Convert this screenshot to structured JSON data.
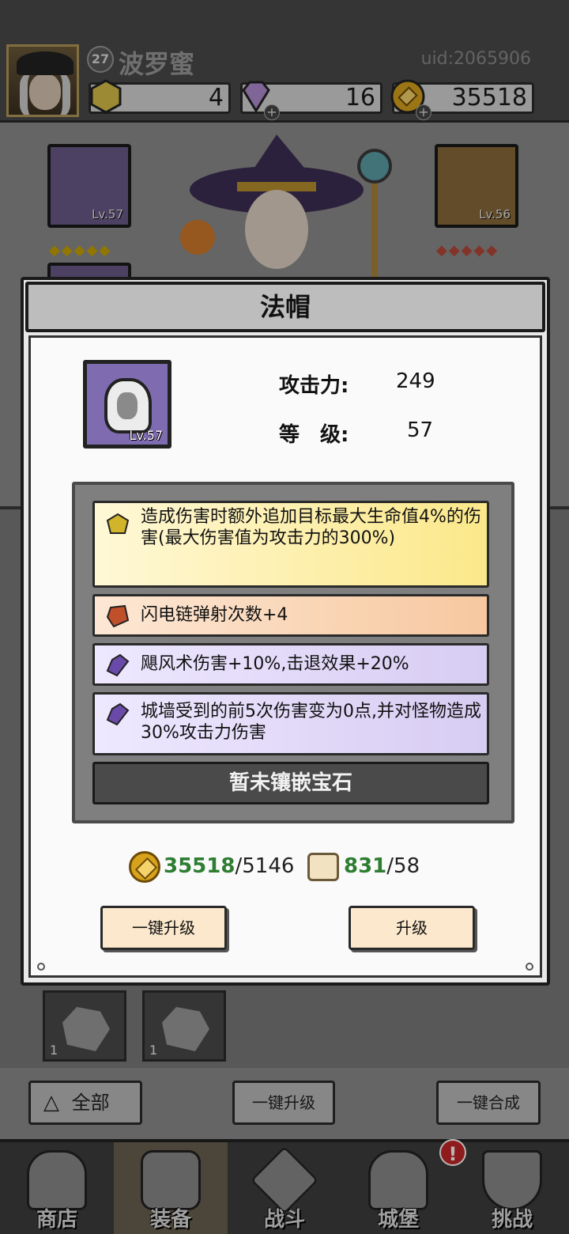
{
  "player": {
    "level": "27",
    "name": "波罗蜜",
    "uid": "uid:2065906"
  },
  "resources": {
    "gold_gem": "4",
    "diamond": "16",
    "coin": "35518"
  },
  "equipment_slots": {
    "left_level": "Lv.57",
    "right_level": "Lv.56"
  },
  "modal": {
    "title": "法帽",
    "item_level": "Lv.57",
    "attack_label": "攻击力:",
    "attack_value": "249",
    "level_label": "等　级:",
    "level_value": "57",
    "attributes": [
      {
        "text": "造成伤害时额外追加目标最大生命值4%的伤害(最大伤害值为攻击力的300%)",
        "gem": "yellow-gem-icon"
      },
      {
        "text": "闪电链弹射次数+4",
        "gem": "orange-gem-icon"
      },
      {
        "text": "飓风术伤害+10%,击退效果+20%",
        "gem": "purple-gem-icon"
      },
      {
        "text": "城墙受到的前5次伤害变为0点,并对怪物造成30%攻击力伤害",
        "gem": "purple-gem-icon"
      }
    ],
    "no_gem_text": "暂未镶嵌宝石",
    "cost": {
      "coin_have": "35518",
      "coin_need": "/5146",
      "scroll_have": "831",
      "scroll_need": "/58"
    },
    "one_click_upgrade": "一键升级",
    "upgrade": "升级"
  },
  "bottom_buttons": {
    "all": "全部",
    "one_click_upgrade": "一键升级",
    "one_click_merge": "一键合成"
  },
  "inventory": {
    "slot1_count": "1",
    "slot2_count": "1"
  },
  "nav": [
    {
      "label": "商店"
    },
    {
      "label": "装备"
    },
    {
      "label": "战斗"
    },
    {
      "label": "城堡"
    },
    {
      "label": "挑战"
    }
  ],
  "alert_badge": "!",
  "colors": {
    "have_green": "#2e7d32",
    "modal_bg": "#fafafa",
    "purple_slot": "#7e6bb0",
    "coin_gold": "#d8a21c"
  }
}
